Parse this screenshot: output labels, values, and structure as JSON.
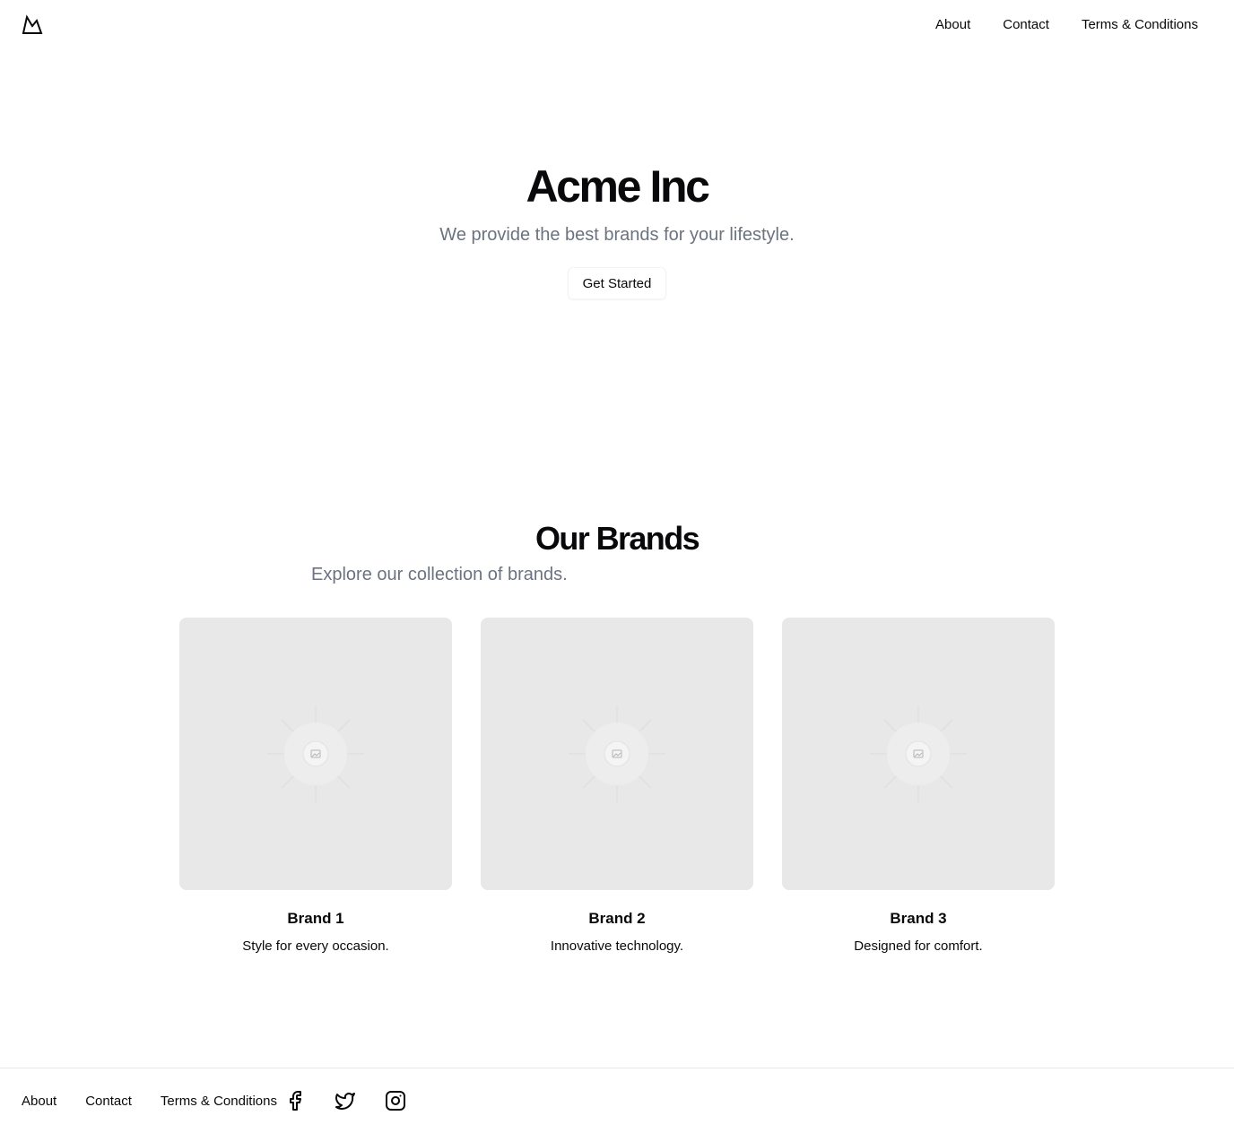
{
  "header": {
    "logo_icon": "mountain-icon",
    "nav": [
      "About",
      "Contact",
      "Terms & Conditions"
    ]
  },
  "hero": {
    "title": "Acme Inc",
    "subtitle": "We provide the best brands for your lifestyle.",
    "cta_label": "Get Started"
  },
  "brands": {
    "title": "Our Brands",
    "subtitle": "Explore our collection of brands.",
    "items": [
      {
        "name": "Brand 1",
        "description": "Style for every occasion.",
        "image_icon": "image-placeholder-icon"
      },
      {
        "name": "Brand 2",
        "description": "Innovative technology.",
        "image_icon": "image-placeholder-icon"
      },
      {
        "name": "Brand 3",
        "description": "Designed for comfort.",
        "image_icon": "image-placeholder-icon"
      }
    ]
  },
  "footer": {
    "nav": [
      "About",
      "Contact",
      "Terms & Conditions"
    ],
    "social_icons": [
      "facebook-icon",
      "twitter-icon",
      "instagram-icon"
    ]
  },
  "colors": {
    "text": "#09090b",
    "muted_text": "#6b7280",
    "placeholder_bg": "#e8e8e8",
    "border": "#e5e7eb"
  }
}
